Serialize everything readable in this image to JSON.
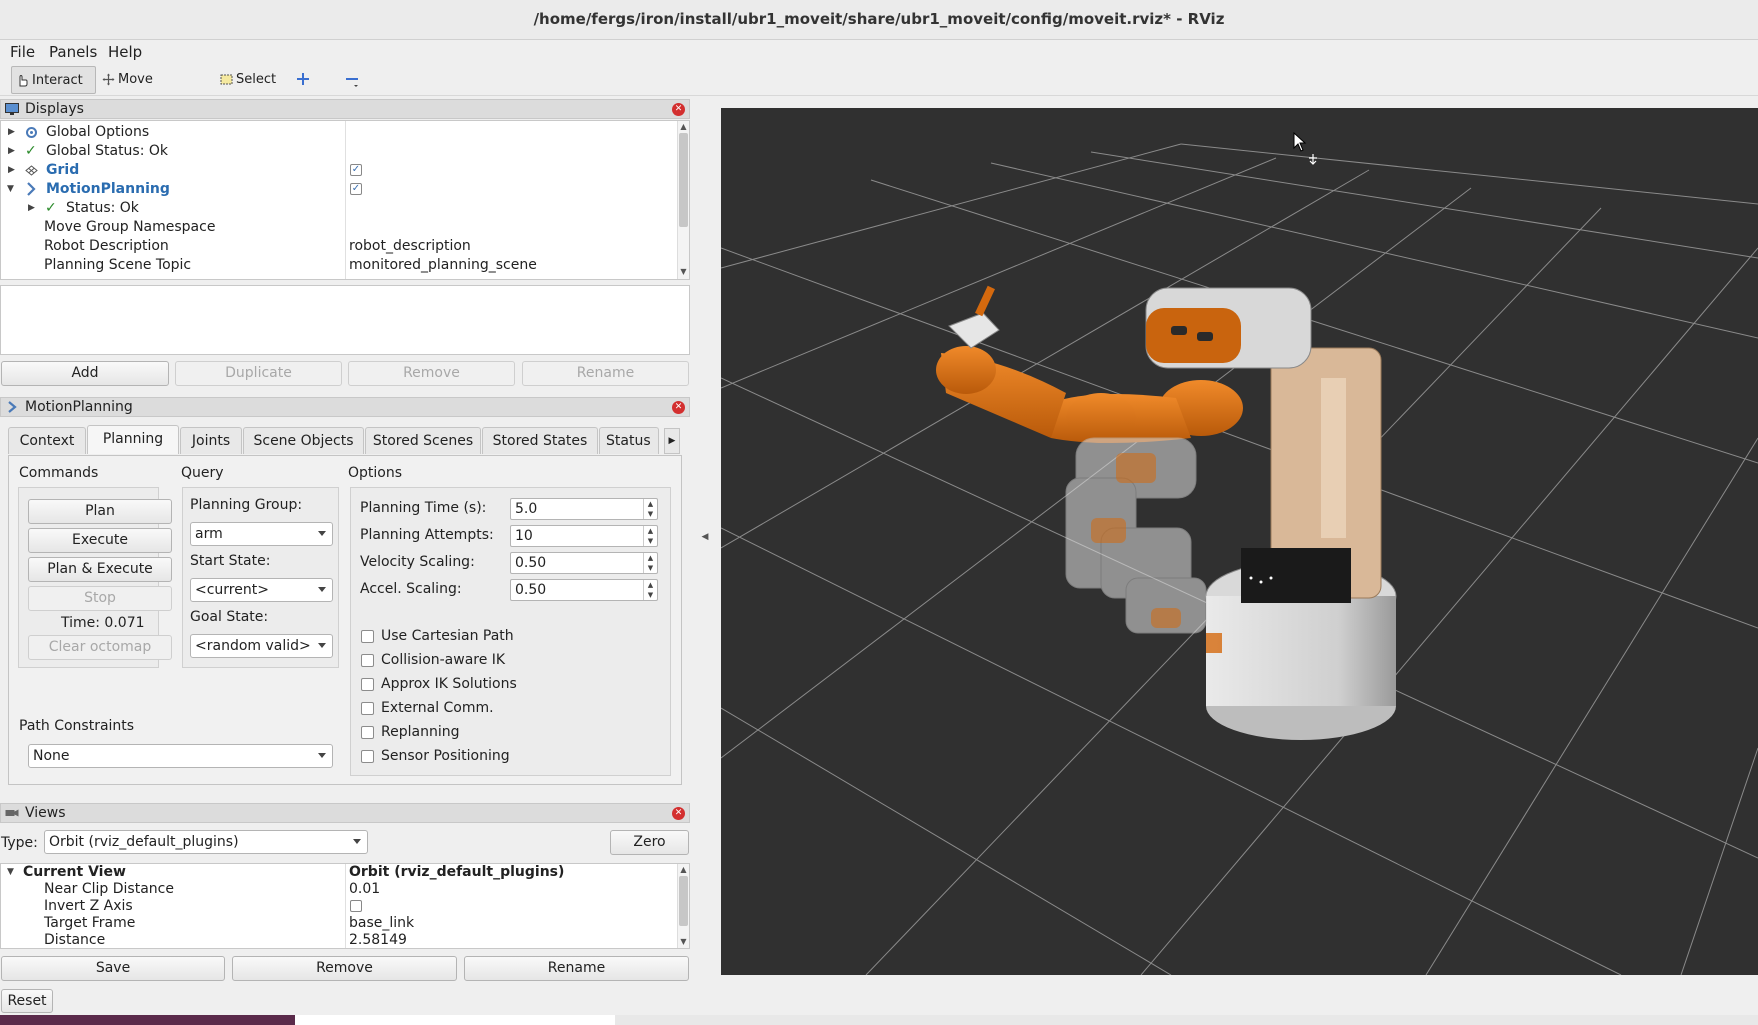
{
  "window": {
    "title": "/home/fergs/iron/install/ubr1_moveit/share/ubr1_moveit/config/moveit.rviz* - RViz"
  },
  "menu": [
    {
      "label": "File"
    },
    {
      "label": "Panels"
    },
    {
      "label": "Help"
    }
  ],
  "toolbar": {
    "interact": "Interact",
    "move_camera": "Move Camera",
    "select": "Select"
  },
  "displays": {
    "title": "Displays",
    "rows": [
      {
        "label": "Global Options",
        "value": ""
      },
      {
        "label": "Global Status: Ok",
        "value": ""
      },
      {
        "label": "Grid",
        "value": "",
        "checked": true
      },
      {
        "label": "MotionPlanning",
        "value": "",
        "checked": true
      },
      {
        "label": "Status: Ok",
        "value": ""
      },
      {
        "label": "Move Group Namespace",
        "value": ""
      },
      {
        "label": "Robot Description",
        "value": "robot_description"
      },
      {
        "label": "Planning Scene Topic",
        "value": "monitored_planning_scene"
      }
    ],
    "buttons": {
      "add": "Add",
      "duplicate": "Duplicate",
      "remove": "Remove",
      "rename": "Rename"
    }
  },
  "motion_planning": {
    "title": "MotionPlanning",
    "tabs": [
      "Context",
      "Planning",
      "Joints",
      "Scene Objects",
      "Stored Scenes",
      "Stored States",
      "Status"
    ],
    "active_tab": "Planning",
    "commands": {
      "heading": "Commands",
      "plan": "Plan",
      "execute": "Execute",
      "plan_execute": "Plan & Execute",
      "stop": "Stop",
      "time": "Time: 0.071",
      "clear_octomap": "Clear octomap"
    },
    "query": {
      "heading": "Query",
      "planning_group_label": "Planning Group:",
      "planning_group": "arm",
      "start_state_label": "Start State:",
      "start_state": "<current>",
      "goal_state_label": "Goal State:",
      "goal_state": "<random valid>"
    },
    "options": {
      "heading": "Options",
      "planning_time_label": "Planning Time (s):",
      "planning_time": "5.0",
      "planning_attempts_label": "Planning Attempts:",
      "planning_attempts": "10",
      "velocity_scaling_label": "Velocity Scaling:",
      "velocity_scaling": "0.50",
      "accel_scaling_label": "Accel. Scaling:",
      "accel_scaling": "0.50",
      "checkboxes": [
        {
          "label": "Use Cartesian Path",
          "checked": false
        },
        {
          "label": "Collision-aware IK",
          "checked": false
        },
        {
          "label": "Approx IK Solutions",
          "checked": false
        },
        {
          "label": "External Comm.",
          "checked": false
        },
        {
          "label": "Replanning",
          "checked": false
        },
        {
          "label": "Sensor Positioning",
          "checked": false
        }
      ]
    },
    "path_constraints": {
      "label": "Path Constraints",
      "value": "None"
    }
  },
  "views": {
    "title": "Views",
    "type_label": "Type:",
    "type_value": "Orbit (rviz_default_plugins)",
    "zero": "Zero",
    "rows": [
      {
        "label": "Current View",
        "value": "Orbit (rviz_default_plugins)"
      },
      {
        "label": "Near Clip Distance",
        "value": "0.01"
      },
      {
        "label": "Invert Z Axis",
        "value": ""
      },
      {
        "label": "Target Frame",
        "value": "base_link"
      },
      {
        "label": "Distance",
        "value": "2.58149"
      }
    ],
    "buttons": {
      "save": "Save",
      "remove": "Remove",
      "rename": "Rename"
    }
  },
  "reset": "Reset",
  "colors": {
    "viewport_bg": "#303030",
    "robot_orange": "#d4690e",
    "accent_blue": "#2a6cb0"
  }
}
